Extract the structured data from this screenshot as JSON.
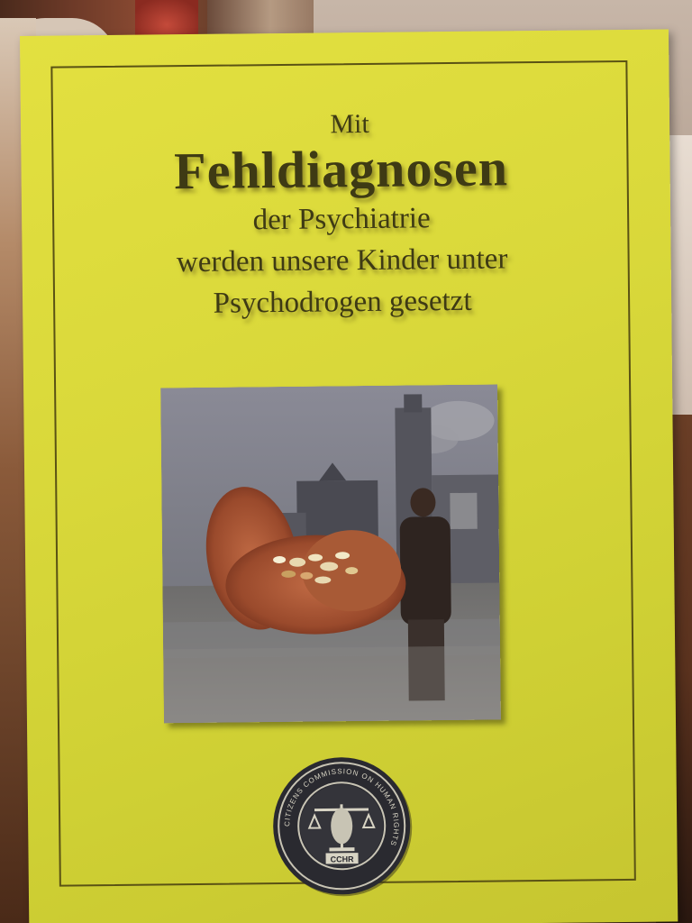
{
  "booklet": {
    "title_mit": "Mit",
    "title_main": "Fehldiagnosen",
    "title_line1": "der Psychiatrie",
    "title_line2": "werden unsere Kinder unter",
    "title_line3": "Psychodrogen gesetzt",
    "seal_label": "CCHR",
    "seal_ring_text": "CITIZENS COMMISSION ON HUMAN RIGHTS"
  },
  "colors": {
    "cover": "#dcda3a",
    "title_ink": "#3e3a14"
  },
  "icons": {
    "photo": "hands-holding-pills-photo",
    "seal": "cchr-seal-logo"
  }
}
